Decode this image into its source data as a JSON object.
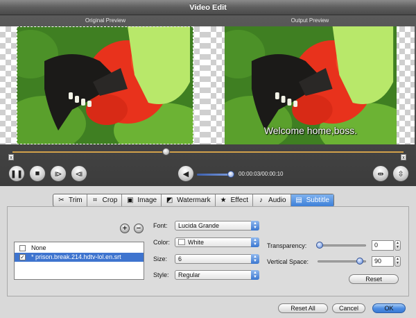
{
  "window": {
    "title": "Video Edit"
  },
  "preview": {
    "original_label": "Original Preview",
    "output_label": "Output Preview",
    "subtitle_text": "Welcome home,boss."
  },
  "timeline": {
    "left_marker": "x",
    "right_marker": "x"
  },
  "player": {
    "timecode": "00:00:03/00:00:10"
  },
  "tabs": [
    {
      "label": "Trim",
      "icon": "scissors-icon"
    },
    {
      "label": "Crop",
      "icon": "crop-icon"
    },
    {
      "label": "Image",
      "icon": "image-icon"
    },
    {
      "label": "Watermark",
      "icon": "watermark-icon"
    },
    {
      "label": "Effect",
      "icon": "star-icon"
    },
    {
      "label": "Audio",
      "icon": "music-note-icon"
    },
    {
      "label": "Subtitle",
      "icon": "subtitle-icon",
      "active": true
    }
  ],
  "subtitle_list": [
    {
      "label": "None",
      "checked": false,
      "selected": false
    },
    {
      "label": "* prison.break.214.hdtv-lol.en.srt",
      "checked": true,
      "selected": true
    }
  ],
  "form": {
    "font_label": "Font:",
    "font_value": "Lucida Grande",
    "color_label": "Color:",
    "color_value": "White",
    "size_label": "Size:",
    "size_value": "6",
    "style_label": "Style:",
    "style_value": "Regular",
    "transparency_label": "Transparency:",
    "transparency_value": "0",
    "vertical_label": "Vertical Space:",
    "vertical_value": "90",
    "reset_label": "Reset"
  },
  "footer": {
    "reset_all": "Reset All",
    "cancel": "Cancel",
    "ok": "OK"
  },
  "colors": {
    "accent": "#3e74cf",
    "timeline": "#d2a14b",
    "flower": "#e8321c",
    "leaf": "#5aa02c"
  }
}
